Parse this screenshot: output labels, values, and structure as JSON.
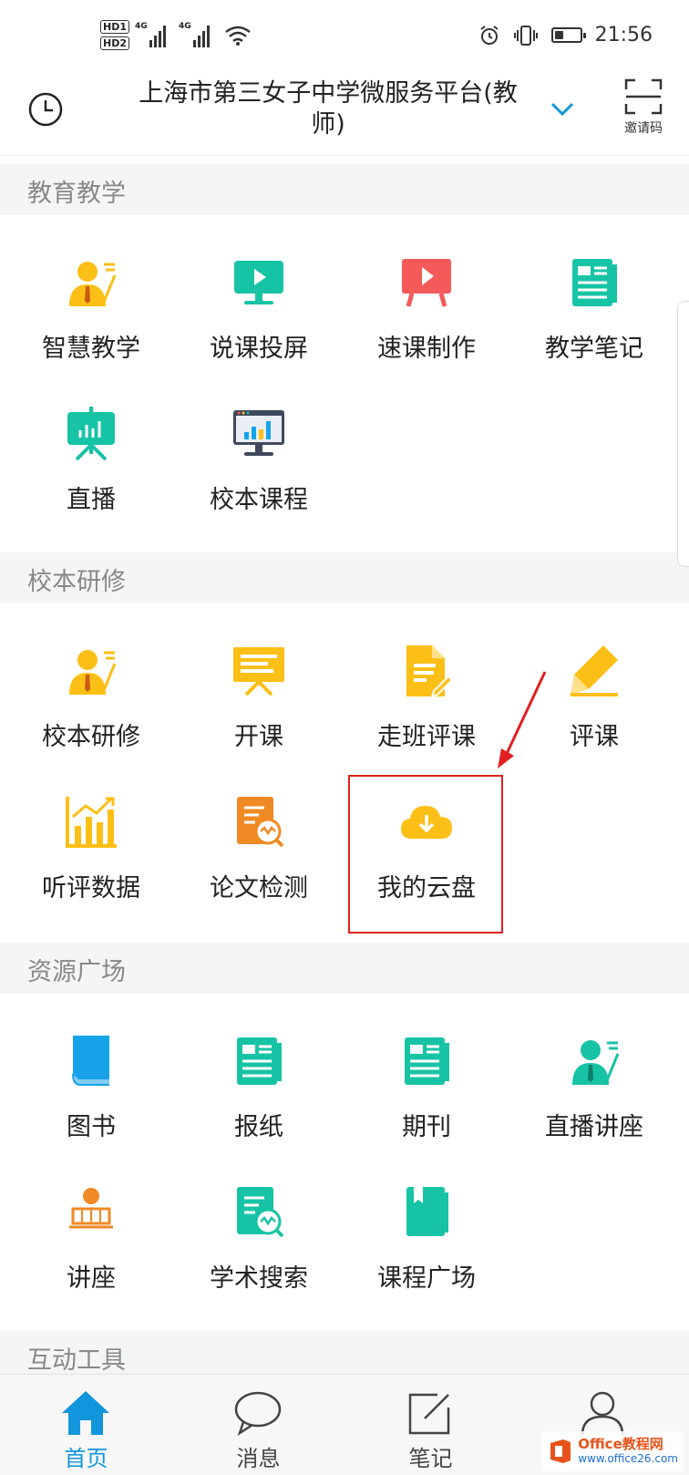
{
  "status_bar": {
    "hd1": "HD1",
    "hd2": "HD2",
    "net1": "4G",
    "net2": "4G",
    "time": "21:56",
    "battery_level": 0.35
  },
  "header": {
    "title_line1": "上海市第三女子中学微服务平台(教",
    "title_line2": "师)",
    "scan_label": "邀请码",
    "accent": "#1296db"
  },
  "sections": [
    {
      "title": "教育教学",
      "items": [
        {
          "label": "智慧教学",
          "icon": "teacher-icon"
        },
        {
          "label": "说课投屏",
          "icon": "screen-play-icon"
        },
        {
          "label": "速课制作",
          "icon": "easel-play-icon"
        },
        {
          "label": "教学笔记",
          "icon": "notes-icon"
        },
        {
          "label": "直播",
          "icon": "live-board-icon"
        },
        {
          "label": "校本课程",
          "icon": "monitor-chart-icon"
        }
      ]
    },
    {
      "title": "校本研修",
      "items": [
        {
          "label": "校本研修",
          "icon": "teacher-icon"
        },
        {
          "label": "开课",
          "icon": "presentation-icon"
        },
        {
          "label": "走班评课",
          "icon": "document-edit-icon"
        },
        {
          "label": "评课",
          "icon": "pencil-icon"
        },
        {
          "label": "听评数据",
          "icon": "bar-chart-icon"
        },
        {
          "label": "论文检测",
          "icon": "paper-check-icon"
        },
        {
          "label": "我的云盘",
          "icon": "cloud-download-icon"
        }
      ]
    },
    {
      "title": "资源广场",
      "items": [
        {
          "label": "图书",
          "icon": "book-icon"
        },
        {
          "label": "报纸",
          "icon": "newspaper-icon"
        },
        {
          "label": "期刊",
          "icon": "journal-icon"
        },
        {
          "label": "直播讲座",
          "icon": "lecturer-icon"
        },
        {
          "label": "讲座",
          "icon": "podium-icon"
        },
        {
          "label": "学术搜索",
          "icon": "doc-search-icon"
        },
        {
          "label": "课程广场",
          "icon": "bookmark-book-icon"
        }
      ]
    },
    {
      "title": "互动工具",
      "items": []
    }
  ],
  "tabbar": {
    "items": [
      {
        "label": "首页",
        "icon": "home-icon",
        "active": true
      },
      {
        "label": "消息",
        "icon": "chat-bubble-icon",
        "active": false
      },
      {
        "label": "笔记",
        "icon": "note-edit-icon",
        "active": false
      },
      {
        "label": "",
        "icon": "user-icon",
        "active": false
      }
    ]
  },
  "watermark": {
    "line1": "Office教程网",
    "line2": "www.office26.com"
  },
  "colors": {
    "teal": "#17c3a5",
    "yellow": "#fcbf16",
    "red": "#f45a5a",
    "blue": "#16a3ea",
    "orange": "#f08a24",
    "highlight": "#e02020"
  }
}
